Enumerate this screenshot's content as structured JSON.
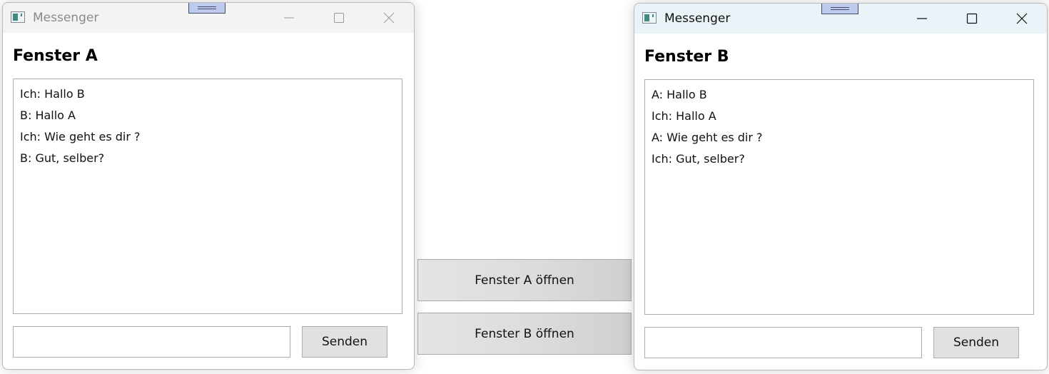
{
  "window_a": {
    "title": "Messenger",
    "heading": "Fenster A",
    "messages": [
      "Ich: Hallo B",
      "B: Hallo A",
      "Ich: Wie geht es dir ?",
      "B: Gut, selber?"
    ],
    "input_value": "",
    "send_label": "Senden"
  },
  "window_b": {
    "title": "Messenger",
    "heading": "Fenster B",
    "messages": [
      "A: Hallo B",
      "Ich: Hallo A",
      "A: Wie geht es dir ?",
      "Ich: Gut, selber?"
    ],
    "input_value": "",
    "send_label": "Senden"
  },
  "launcher": {
    "open_a_label": "Fenster A öffnen",
    "open_b_label": "Fenster B öffnen"
  },
  "icons": {
    "app": "messenger-app-icon",
    "grip": "window-grip-icon",
    "minimize": "minimize-icon",
    "maximize": "maximize-icon",
    "close": "close-icon"
  },
  "colors": {
    "inactive_titlebar": "#f3f3f3",
    "active_titlebar": "#eaf3f8",
    "button_face": "#e1e1e1"
  }
}
